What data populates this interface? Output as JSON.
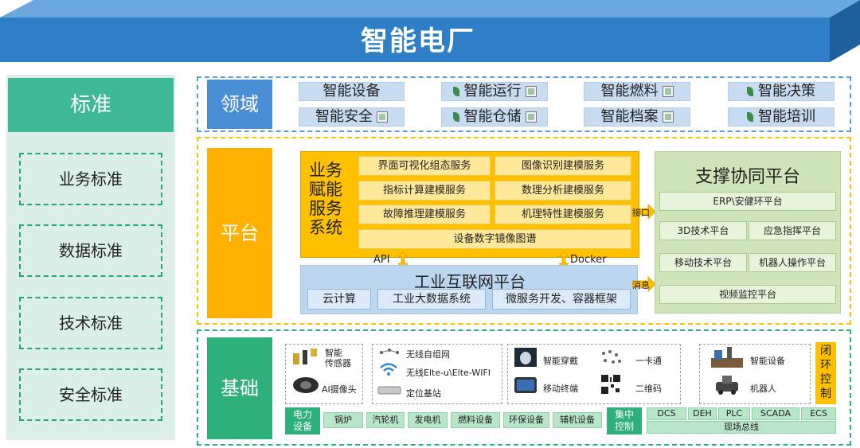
{
  "title": "智能电厂",
  "standards": {
    "header": "标准",
    "items": [
      "业务标准",
      "数据标准",
      "技术标准",
      "安全标准"
    ]
  },
  "domain": {
    "label": "领域",
    "items": [
      "智能设备",
      "智能运行",
      "智能燃料",
      "智能决策",
      "智能安全",
      "智能仓储",
      "智能档案",
      "智能培训"
    ]
  },
  "platform": {
    "label": "平台",
    "business": {
      "label": "业务赋能服务系统",
      "services": [
        "界面可视化组态服务",
        "图像识别建模服务",
        "指标计算建模服务",
        "数理分析建模服务",
        "故障推理建模服务",
        "机理特性建模服务",
        "设备数字镜像图谱"
      ]
    },
    "connectors": {
      "api": "API",
      "docker": "Docker",
      "interface": "接口",
      "message": "消息"
    },
    "industrial": {
      "title": "工业互联网平台",
      "items": [
        "云计算",
        "工业大数据系统",
        "微服务开发、容器框架"
      ]
    },
    "support": {
      "title": "支撑协同平台",
      "items": [
        "ERP\\安健环平台",
        "3D技术平台",
        "应急指挥平台",
        "移动技术平台",
        "机器人操作平台",
        "视频监控平台"
      ]
    }
  },
  "base": {
    "label": "基础",
    "sensors": {
      "smart_sensor": "智能\n传感器",
      "ai_camera": "AI摄像头"
    },
    "network": {
      "mesh": "无线自组网",
      "elte": "无线Elte-u\\Elte-WIFI",
      "station": "定位基站"
    },
    "terminals": {
      "wearable": "智能穿戴",
      "card": "一卡通",
      "mobile": "移动终端",
      "qrcode": "二维码"
    },
    "smart": {
      "device": "智能设备",
      "robot": "机器人"
    },
    "closed_loop": "闭环控制",
    "power_equipment": {
      "head": "电力设备",
      "items": [
        "锅炉",
        "汽轮机",
        "发电机",
        "燃料设备",
        "环保设备",
        "辅机设备"
      ]
    },
    "control": {
      "head": "集中控制",
      "systems": [
        "DCS",
        "DEH",
        "PLC",
        "SCADA",
        "ECS"
      ],
      "bus": "现场总线"
    }
  },
  "colors": {
    "banner": "#2f7fc8",
    "standards": "#3fb897",
    "domain": "#4a8fd6",
    "platform": "#ffb000",
    "base": "#2eb07a",
    "support": "#cfe4b8"
  }
}
